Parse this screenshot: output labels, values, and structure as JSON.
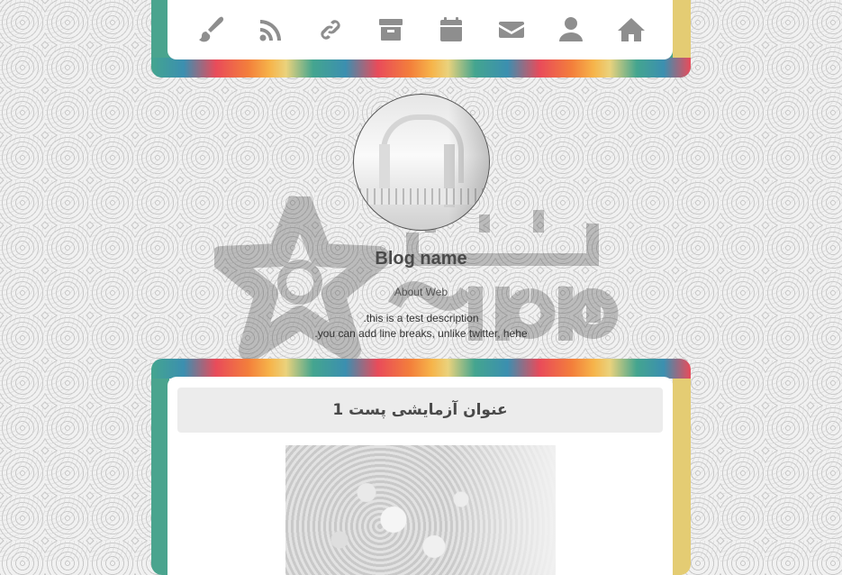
{
  "nav": {
    "icons": [
      "brush-icon",
      "rss-icon",
      "link-icon",
      "archive-icon",
      "calendar-icon",
      "mail-icon",
      "user-icon",
      "home-icon"
    ],
    "icon_color": "#8e8e8e"
  },
  "profile": {
    "blog_name": "Blog name",
    "about_label": "About Web",
    "description_line1": ".this is a test description",
    "description_line2": ".you can add line breaks, unlike twitter, hehe"
  },
  "posts": [
    {
      "title": "عنوان آزمایشی پست 1"
    }
  ],
  "colors": {
    "frame_left": "#4aa48e",
    "frame_right": "#e4cc73",
    "rainbow": [
      "#44a58f",
      "#3b8fb0",
      "#e94b5a",
      "#f37f3b",
      "#f6b44a",
      "#ead27c"
    ],
    "panel_bg": "#ffffff",
    "title_bar_bg": "#ececec"
  }
}
